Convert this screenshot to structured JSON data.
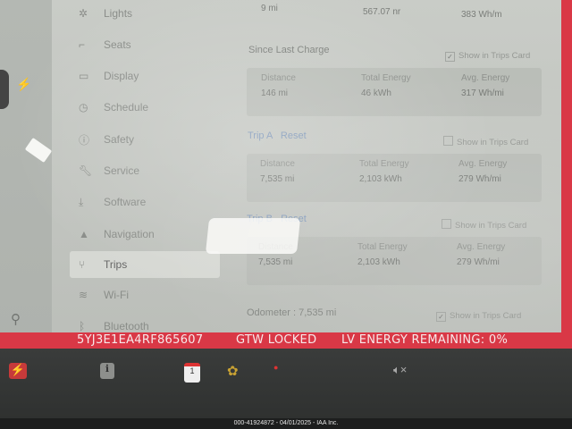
{
  "sidebar": {
    "items": [
      {
        "label": "Lights",
        "icon": "lights-icon"
      },
      {
        "label": "Seats",
        "icon": "seat-icon"
      },
      {
        "label": "Display",
        "icon": "display-icon"
      },
      {
        "label": "Schedule",
        "icon": "schedule-icon"
      },
      {
        "label": "Safety",
        "icon": "safety-icon"
      },
      {
        "label": "Service",
        "icon": "wrench-icon"
      },
      {
        "label": "Software",
        "icon": "download-icon"
      },
      {
        "label": "Navigation",
        "icon": "navigation-arrow-icon"
      },
      {
        "label": "Trips",
        "icon": "trips-icon"
      },
      {
        "label": "Wi-Fi",
        "icon": "wifi-icon"
      },
      {
        "label": "Bluetooth",
        "icon": "bluetooth-icon"
      }
    ],
    "active": "Trips"
  },
  "top_row": {
    "distance": "9 mi",
    "energy": "567.07 nr",
    "avg": "383 Wh/m"
  },
  "since_last_charge": {
    "title": "Since Last Charge",
    "show_label": "Show in Trips Card",
    "distance_label": "Distance",
    "distance": "146 mi",
    "energy_label": "Total Energy",
    "energy": "46 kWh",
    "avg_label": "Avg. Energy",
    "avg": "317 Wh/mi"
  },
  "trip_a": {
    "title": "Trip A",
    "reset": "Reset",
    "show_label": "Show in Trips Card",
    "distance_label": "Distance",
    "distance": "7,535 mi",
    "energy_label": "Total Energy",
    "energy": "2,103 kWh",
    "avg_label": "Avg. Energy",
    "avg": "279 Wh/mi"
  },
  "trip_b": {
    "title": "Trip B",
    "reset": "Reset",
    "show_label": "Show in Trips Card",
    "distance_label": "Distance",
    "distance": "7,535 mi",
    "energy_label": "Total Energy",
    "energy": "2,103 kWh",
    "avg_label": "Avg. Energy",
    "avg": "279 Wh/mi"
  },
  "odometer": {
    "label": "Odometer :",
    "value": "7,535 mi",
    "show_label": "Show in Trips Card"
  },
  "banner": {
    "vin": "5YJ3E1EA4RF865607",
    "gtw": "GTW LOCKED",
    "lv": "LV ENERGY REMAINING: 0%"
  },
  "taskbar": {
    "calendar_day": "1"
  },
  "caption": "000-41924872 - 04/01/2025 - IAA Inc.",
  "colors": {
    "banner": "#d93846",
    "link": "#7f97b8"
  }
}
